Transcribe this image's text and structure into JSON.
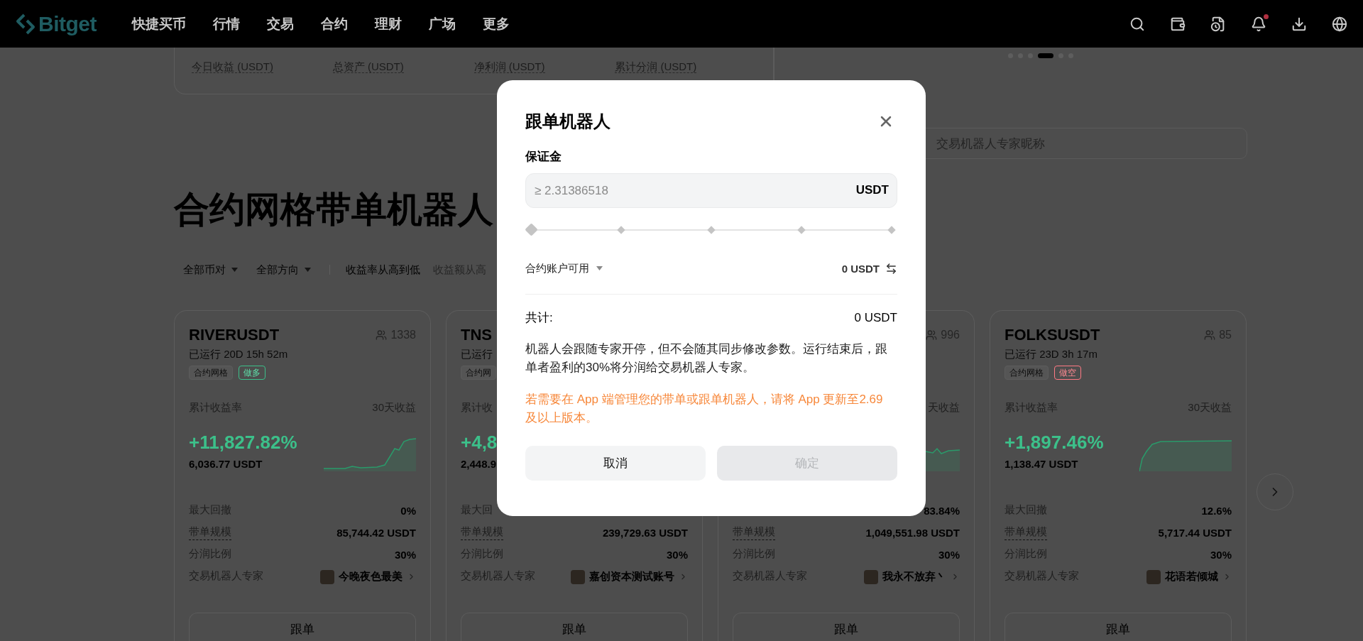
{
  "nav": {
    "logo": "Bitget",
    "items": [
      "快捷买币",
      "行情",
      "交易",
      "合约",
      "理财",
      "广场",
      "更多"
    ],
    "unread": true
  },
  "stats": [
    "今日收益 (USDT)",
    "总资产 (USDT)",
    "净利润 (USDT)",
    "累计分润 (USDT)"
  ],
  "carousel": [
    {
      "selected": false
    },
    {
      "selected": false
    },
    {
      "selected": false
    },
    {
      "selected": true
    },
    {
      "selected": false
    },
    {
      "selected": false
    }
  ],
  "search": {
    "placeholder": "交易机器人专家昵称"
  },
  "heading": "合约网格带单机器人",
  "filters": [
    {
      "kind": "dropdown",
      "label": "全部币对"
    },
    {
      "kind": "dropdown",
      "label": "全部方向"
    },
    {
      "kind": "sort",
      "label": "收益率从高到低",
      "selected": true
    },
    {
      "kind": "sort",
      "label": "收益额从高",
      "selected": false
    }
  ],
  "cards": [
    {
      "pair": "RIVERUSDT",
      "followers": "1338",
      "runtime": "已运行 20D 15h 52m",
      "tags": [
        {
          "label": "合约网格",
          "kind": "plain"
        },
        {
          "label": "做多",
          "kind": "long"
        }
      ],
      "yield_label": "累计收益率",
      "pnl_label": "30天收益",
      "yield": "+11,827.82%",
      "profit": "6,036.77 USDT",
      "stats": [
        {
          "label": "最大回撤",
          "value": "0%",
          "hint": false
        },
        {
          "label": "带单规模",
          "value": "85,744.42 USDT",
          "hint": true
        },
        {
          "label": "分润比例",
          "value": "30%",
          "hint": false
        }
      ],
      "expert": {
        "label": "交易机器人专家",
        "name": "今晚夜色最美"
      },
      "button": "跟单"
    },
    {
      "pair": "TNS",
      "runtime": "已运行",
      "tags": [
        {
          "label": "合约网",
          "kind": "plain"
        }
      ],
      "yield_label": "累计收",
      "yield": "+4,8",
      "profit": "2,448.9",
      "stats": [
        {
          "label": "最大回",
          "hint": false
        },
        {
          "label": "带单规模",
          "value": "239,729.63 USDT",
          "hint": true
        },
        {
          "label": "分润比例",
          "value": "30%",
          "hint": false
        }
      ],
      "expert": {
        "label": "交易机器人专家",
        "name": "嘉创资本测试账号"
      },
      "button": "跟单"
    },
    {
      "followers": "996",
      "pnl_label": "天收益",
      "stats": [
        {
          "value": "83.84%"
        },
        {
          "label": "带单规模",
          "value": "1,049,551.98 USDT",
          "hint": true
        },
        {
          "label": "分润比例",
          "value": "30%",
          "hint": false
        }
      ],
      "expert": {
        "label": "交易机器人专家",
        "name": "我永不放弃丶"
      },
      "button": "跟单"
    },
    {
      "pair": "FOLKSUSDT",
      "followers": "85",
      "runtime": "已运行 23D 3h 17m",
      "tags": [
        {
          "label": "合约网格",
          "kind": "plain"
        },
        {
          "label": "做空",
          "kind": "short"
        }
      ],
      "yield_label": "累计收益率",
      "pnl_label": "30天收益",
      "yield": "+1,897.46%",
      "profit": "1,138.47 USDT",
      "stats": [
        {
          "label": "最大回撤",
          "value": "12.6%",
          "hint": false
        },
        {
          "label": "带单规模",
          "value": "5,717.44 USDT",
          "hint": true
        },
        {
          "label": "分润比例",
          "value": "30%",
          "hint": false
        }
      ],
      "expert": {
        "label": "交易机器人专家",
        "name": "花语若倾城"
      },
      "button": "跟单"
    }
  ],
  "modal": {
    "title": "跟单机器人",
    "margin_label": "保证金",
    "input": {
      "placeholder": "≥ 2.31386518",
      "unit": "USDT"
    },
    "slider": {
      "level": 0
    },
    "account": {
      "label": "合约账户可用",
      "value": "0 USDT"
    },
    "total": {
      "label": "共计:",
      "value": "0 USDT"
    },
    "note": "机器人会跟随专家开停，但不会随其同步修改参数。运行结束后，跟单者盈利的30%将分润给交易机器人专家。",
    "warning": "若需要在 App 端管理您的带单或跟单机器人，请将 App 更新至2.69 及以上版本。",
    "buttons": [
      {
        "label": "取消",
        "kind": "secondary",
        "disabled": false
      },
      {
        "label": "确定",
        "kind": "primary",
        "disabled": true
      }
    ]
  }
}
